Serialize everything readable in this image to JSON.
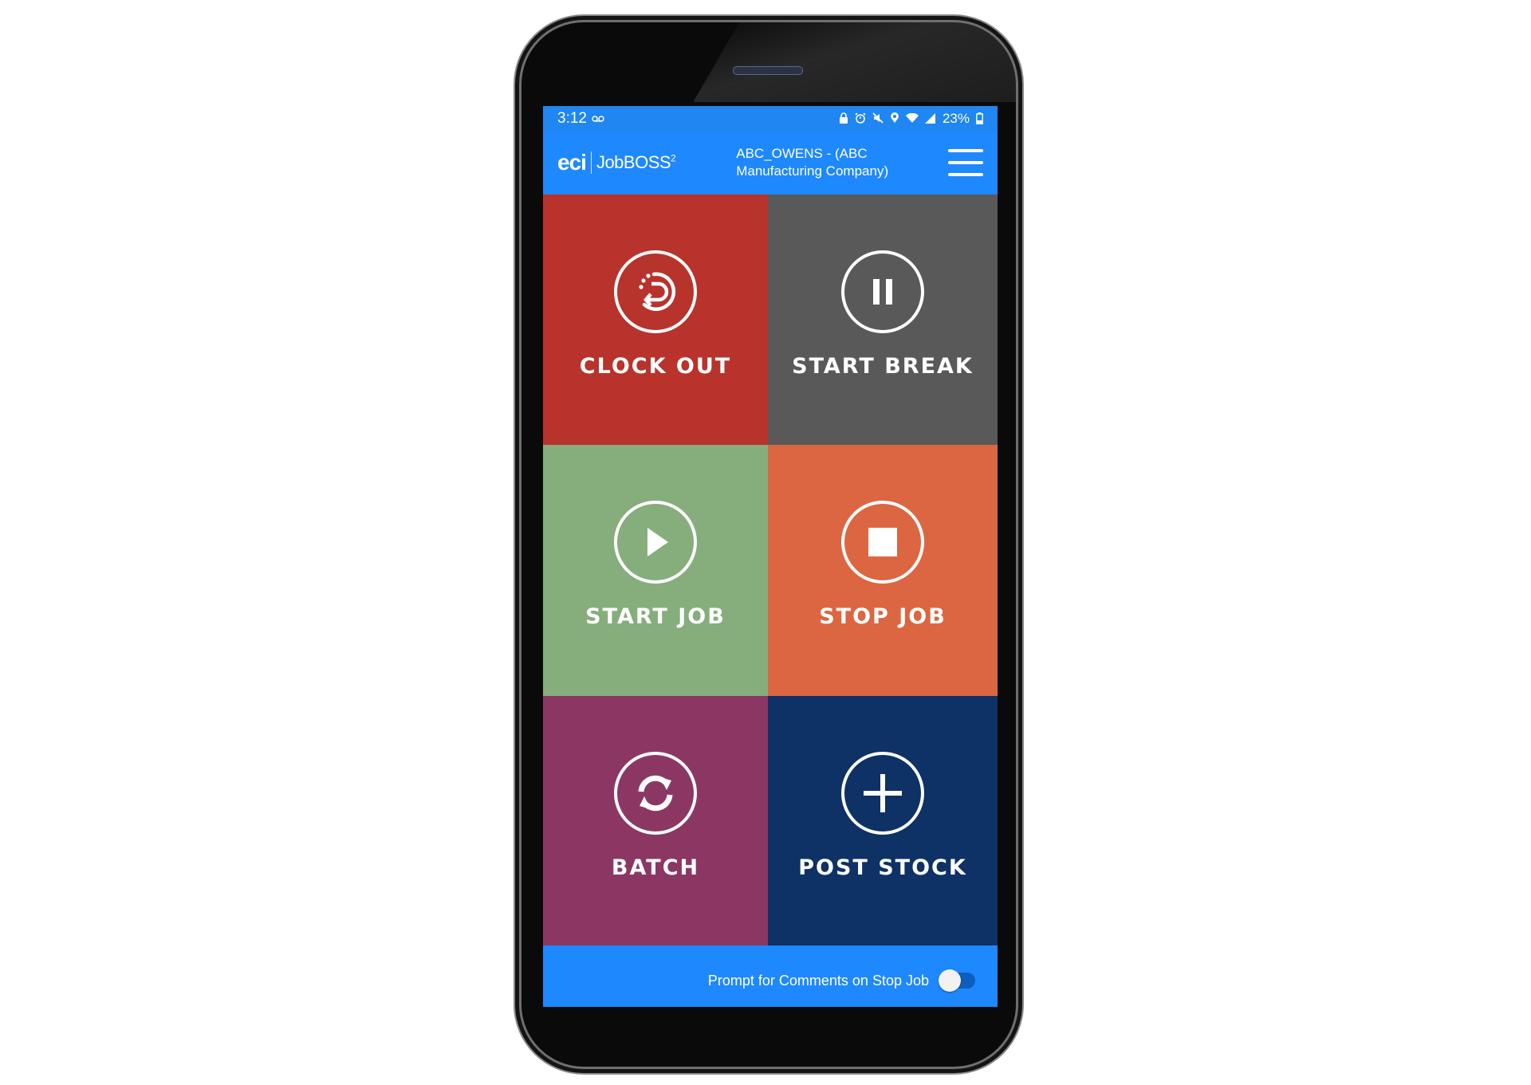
{
  "status_bar": {
    "time": "3:12",
    "battery": "23%",
    "icons": [
      "voicemail-icon",
      "lock-icon",
      "alarm-icon",
      "mute-icon",
      "location-icon",
      "wifi-icon",
      "signal-icon",
      "battery-icon"
    ]
  },
  "app_bar": {
    "logo_eci": "eci",
    "logo_product": "JobBOSS",
    "logo_superscript": "2",
    "company_line1": "ABC_OWENS - (ABC",
    "company_line2": "Manufacturing Company)",
    "menu_icon": "hamburger-menu-icon"
  },
  "tiles": [
    {
      "label": "CLOCK OUT",
      "icon": "clock-out-icon",
      "color": "#b8332c"
    },
    {
      "label": "START BREAK",
      "icon": "pause-icon",
      "color": "#595959"
    },
    {
      "label": "START JOB",
      "icon": "play-icon",
      "color": "#86ad7c"
    },
    {
      "label": "STOP JOB",
      "icon": "stop-icon",
      "color": "#dc6642"
    },
    {
      "label": "BATCH",
      "icon": "refresh-icon",
      "color": "#8c3763"
    },
    {
      "label": "POST STOCK",
      "icon": "plus-icon",
      "color": "#0e3166"
    }
  ],
  "footer": {
    "label": "Prompt for Comments on Stop Job",
    "toggle_on": false
  },
  "colors": {
    "brand_blue": "#1e88ff"
  }
}
